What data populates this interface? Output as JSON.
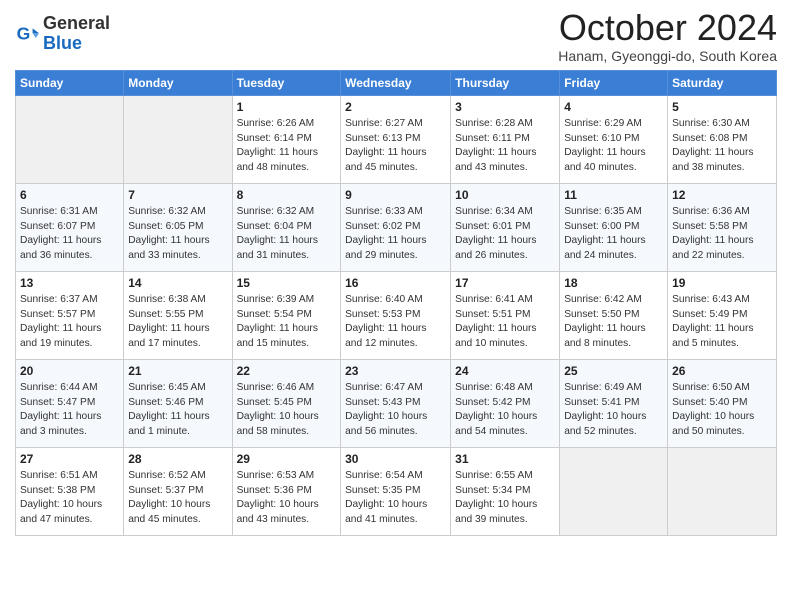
{
  "header": {
    "logo_general": "General",
    "logo_blue": "Blue",
    "month_title": "October 2024",
    "location": "Hanam, Gyeonggi-do, South Korea"
  },
  "weekdays": [
    "Sunday",
    "Monday",
    "Tuesday",
    "Wednesday",
    "Thursday",
    "Friday",
    "Saturday"
  ],
  "weeks": [
    [
      {
        "day": "",
        "info": ""
      },
      {
        "day": "",
        "info": ""
      },
      {
        "day": "1",
        "info": "Sunrise: 6:26 AM\nSunset: 6:14 PM\nDaylight: 11 hours and 48 minutes."
      },
      {
        "day": "2",
        "info": "Sunrise: 6:27 AM\nSunset: 6:13 PM\nDaylight: 11 hours and 45 minutes."
      },
      {
        "day": "3",
        "info": "Sunrise: 6:28 AM\nSunset: 6:11 PM\nDaylight: 11 hours and 43 minutes."
      },
      {
        "day": "4",
        "info": "Sunrise: 6:29 AM\nSunset: 6:10 PM\nDaylight: 11 hours and 40 minutes."
      },
      {
        "day": "5",
        "info": "Sunrise: 6:30 AM\nSunset: 6:08 PM\nDaylight: 11 hours and 38 minutes."
      }
    ],
    [
      {
        "day": "6",
        "info": "Sunrise: 6:31 AM\nSunset: 6:07 PM\nDaylight: 11 hours and 36 minutes."
      },
      {
        "day": "7",
        "info": "Sunrise: 6:32 AM\nSunset: 6:05 PM\nDaylight: 11 hours and 33 minutes."
      },
      {
        "day": "8",
        "info": "Sunrise: 6:32 AM\nSunset: 6:04 PM\nDaylight: 11 hours and 31 minutes."
      },
      {
        "day": "9",
        "info": "Sunrise: 6:33 AM\nSunset: 6:02 PM\nDaylight: 11 hours and 29 minutes."
      },
      {
        "day": "10",
        "info": "Sunrise: 6:34 AM\nSunset: 6:01 PM\nDaylight: 11 hours and 26 minutes."
      },
      {
        "day": "11",
        "info": "Sunrise: 6:35 AM\nSunset: 6:00 PM\nDaylight: 11 hours and 24 minutes."
      },
      {
        "day": "12",
        "info": "Sunrise: 6:36 AM\nSunset: 5:58 PM\nDaylight: 11 hours and 22 minutes."
      }
    ],
    [
      {
        "day": "13",
        "info": "Sunrise: 6:37 AM\nSunset: 5:57 PM\nDaylight: 11 hours and 19 minutes."
      },
      {
        "day": "14",
        "info": "Sunrise: 6:38 AM\nSunset: 5:55 PM\nDaylight: 11 hours and 17 minutes."
      },
      {
        "day": "15",
        "info": "Sunrise: 6:39 AM\nSunset: 5:54 PM\nDaylight: 11 hours and 15 minutes."
      },
      {
        "day": "16",
        "info": "Sunrise: 6:40 AM\nSunset: 5:53 PM\nDaylight: 11 hours and 12 minutes."
      },
      {
        "day": "17",
        "info": "Sunrise: 6:41 AM\nSunset: 5:51 PM\nDaylight: 11 hours and 10 minutes."
      },
      {
        "day": "18",
        "info": "Sunrise: 6:42 AM\nSunset: 5:50 PM\nDaylight: 11 hours and 8 minutes."
      },
      {
        "day": "19",
        "info": "Sunrise: 6:43 AM\nSunset: 5:49 PM\nDaylight: 11 hours and 5 minutes."
      }
    ],
    [
      {
        "day": "20",
        "info": "Sunrise: 6:44 AM\nSunset: 5:47 PM\nDaylight: 11 hours and 3 minutes."
      },
      {
        "day": "21",
        "info": "Sunrise: 6:45 AM\nSunset: 5:46 PM\nDaylight: 11 hours and 1 minute."
      },
      {
        "day": "22",
        "info": "Sunrise: 6:46 AM\nSunset: 5:45 PM\nDaylight: 10 hours and 58 minutes."
      },
      {
        "day": "23",
        "info": "Sunrise: 6:47 AM\nSunset: 5:43 PM\nDaylight: 10 hours and 56 minutes."
      },
      {
        "day": "24",
        "info": "Sunrise: 6:48 AM\nSunset: 5:42 PM\nDaylight: 10 hours and 54 minutes."
      },
      {
        "day": "25",
        "info": "Sunrise: 6:49 AM\nSunset: 5:41 PM\nDaylight: 10 hours and 52 minutes."
      },
      {
        "day": "26",
        "info": "Sunrise: 6:50 AM\nSunset: 5:40 PM\nDaylight: 10 hours and 50 minutes."
      }
    ],
    [
      {
        "day": "27",
        "info": "Sunrise: 6:51 AM\nSunset: 5:38 PM\nDaylight: 10 hours and 47 minutes."
      },
      {
        "day": "28",
        "info": "Sunrise: 6:52 AM\nSunset: 5:37 PM\nDaylight: 10 hours and 45 minutes."
      },
      {
        "day": "29",
        "info": "Sunrise: 6:53 AM\nSunset: 5:36 PM\nDaylight: 10 hours and 43 minutes."
      },
      {
        "day": "30",
        "info": "Sunrise: 6:54 AM\nSunset: 5:35 PM\nDaylight: 10 hours and 41 minutes."
      },
      {
        "day": "31",
        "info": "Sunrise: 6:55 AM\nSunset: 5:34 PM\nDaylight: 10 hours and 39 minutes."
      },
      {
        "day": "",
        "info": ""
      },
      {
        "day": "",
        "info": ""
      }
    ]
  ]
}
